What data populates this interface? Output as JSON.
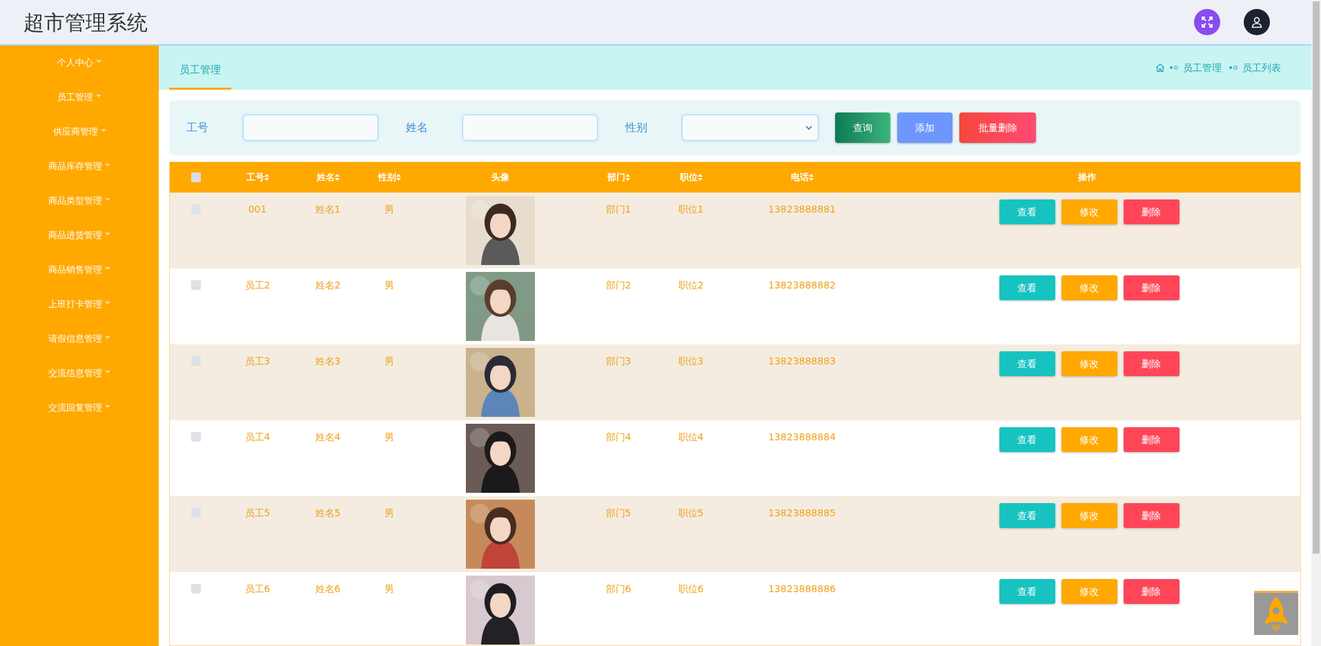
{
  "header": {
    "title": "超市管理系统"
  },
  "sidebar": {
    "items": [
      {
        "label": "个人中心"
      },
      {
        "label": "员工管理"
      },
      {
        "label": "供应商管理"
      },
      {
        "label": "商品库存管理"
      },
      {
        "label": "商品类型管理"
      },
      {
        "label": "商品进货管理"
      },
      {
        "label": "商品销售管理"
      },
      {
        "label": "上班打卡管理"
      },
      {
        "label": "请假信息管理"
      },
      {
        "label": "交流信息管理"
      },
      {
        "label": "交流回复管理"
      }
    ]
  },
  "page_tab": {
    "label": "员工管理",
    "selected": true
  },
  "breadcrumb": [
    "员工管理",
    "员工列表"
  ],
  "search": {
    "fields": [
      {
        "label": "工号",
        "kind": "input"
      },
      {
        "label": "姓名",
        "kind": "input"
      },
      {
        "label": "性别",
        "kind": "select"
      }
    ],
    "buttons": [
      {
        "label": "查询",
        "kind": "search"
      },
      {
        "label": "添加",
        "kind": "add"
      },
      {
        "label": "批量删除",
        "kind": "delete"
      }
    ]
  },
  "table": {
    "select_all": {
      "checked": false
    },
    "columns": [
      {
        "label": "工号",
        "sortable": true
      },
      {
        "label": "姓名",
        "sortable": true
      },
      {
        "label": "性别",
        "sortable": true
      },
      {
        "label": "头像",
        "sortable": false
      },
      {
        "label": "部门",
        "sortable": true
      },
      {
        "label": "职位",
        "sortable": true
      },
      {
        "label": "电话",
        "sortable": true
      },
      {
        "label": "操作",
        "sortable": false
      }
    ],
    "rows": [
      {
        "checked": false,
        "id": "001",
        "name": "姓名1",
        "gender": "男",
        "department": "部门1",
        "position": "职位1",
        "phone": "13823888881",
        "actions": [
          {
            "label": "查看",
            "kind": "view"
          },
          {
            "label": "修改",
            "kind": "edit"
          },
          {
            "label": "删除",
            "kind": "delete"
          }
        ]
      },
      {
        "checked": false,
        "id": "员工2",
        "name": "姓名2",
        "gender": "男",
        "department": "部门2",
        "position": "职位2",
        "phone": "13823888882",
        "actions": [
          {
            "label": "查看",
            "kind": "view"
          },
          {
            "label": "修改",
            "kind": "edit"
          },
          {
            "label": "删除",
            "kind": "delete"
          }
        ]
      },
      {
        "checked": false,
        "id": "员工3",
        "name": "姓名3",
        "gender": "男",
        "department": "部门3",
        "position": "职位3",
        "phone": "13823888883",
        "actions": [
          {
            "label": "查看",
            "kind": "view"
          },
          {
            "label": "修改",
            "kind": "edit"
          },
          {
            "label": "删除",
            "kind": "delete"
          }
        ]
      },
      {
        "checked": false,
        "id": "员工4",
        "name": "姓名4",
        "gender": "男",
        "department": "部门4",
        "position": "职位4",
        "phone": "13823888884",
        "actions": [
          {
            "label": "查看",
            "kind": "view"
          },
          {
            "label": "修改",
            "kind": "edit"
          },
          {
            "label": "删除",
            "kind": "delete"
          }
        ]
      },
      {
        "checked": false,
        "id": "员工5",
        "name": "姓名5",
        "gender": "男",
        "department": "部门5",
        "position": "职位5",
        "phone": "13823888885",
        "actions": [
          {
            "label": "查看",
            "kind": "view"
          },
          {
            "label": "修改",
            "kind": "edit"
          },
          {
            "label": "删除",
            "kind": "delete"
          }
        ]
      },
      {
        "checked": false,
        "id": "员工6",
        "name": "姓名6",
        "gender": "男",
        "department": "部门6",
        "position": "职位6",
        "phone": "13823888886",
        "actions": [
          {
            "label": "查看",
            "kind": "view"
          },
          {
            "label": "修改",
            "kind": "edit"
          },
          {
            "label": "删除",
            "kind": "delete"
          }
        ]
      }
    ]
  }
}
